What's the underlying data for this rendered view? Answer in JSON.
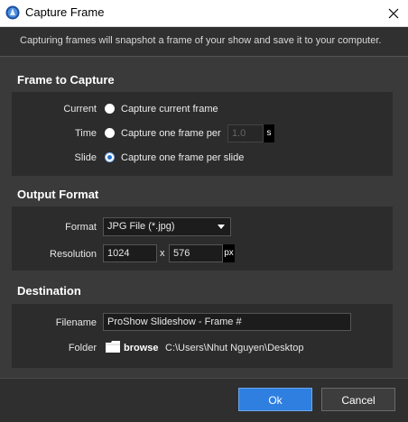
{
  "window": {
    "title": "Capture Frame",
    "description": "Capturing frames will snapshot a frame of your show and save it to your computer."
  },
  "frame_to_capture": {
    "title": "Frame to Capture",
    "options": [
      {
        "label": "Current",
        "text": "Capture current frame",
        "selected": false
      },
      {
        "label": "Time",
        "text": "Capture one frame per",
        "selected": false,
        "value": "1.0",
        "unit": "s"
      },
      {
        "label": "Slide",
        "text": "Capture one frame per slide",
        "selected": true
      }
    ]
  },
  "output_format": {
    "title": "Output Format",
    "format_label": "Format",
    "format_value": "JPG File (*.jpg)",
    "resolution_label": "Resolution",
    "width": "1024",
    "separator": "x",
    "height": "576",
    "unit": "px"
  },
  "destination": {
    "title": "Destination",
    "filename_label": "Filename",
    "filename_value": "ProShow Slideshow - Frame #",
    "folder_label": "Folder",
    "browse_label": "browse",
    "folder_path": "C:\\Users\\Nhut Nguyen\\Desktop"
  },
  "footer": {
    "ok_label": "Ok",
    "cancel_label": "Cancel"
  },
  "colors": {
    "accent": "#2f7fe0",
    "background": "#3a3a3a",
    "panel": "#2c2c2c"
  }
}
